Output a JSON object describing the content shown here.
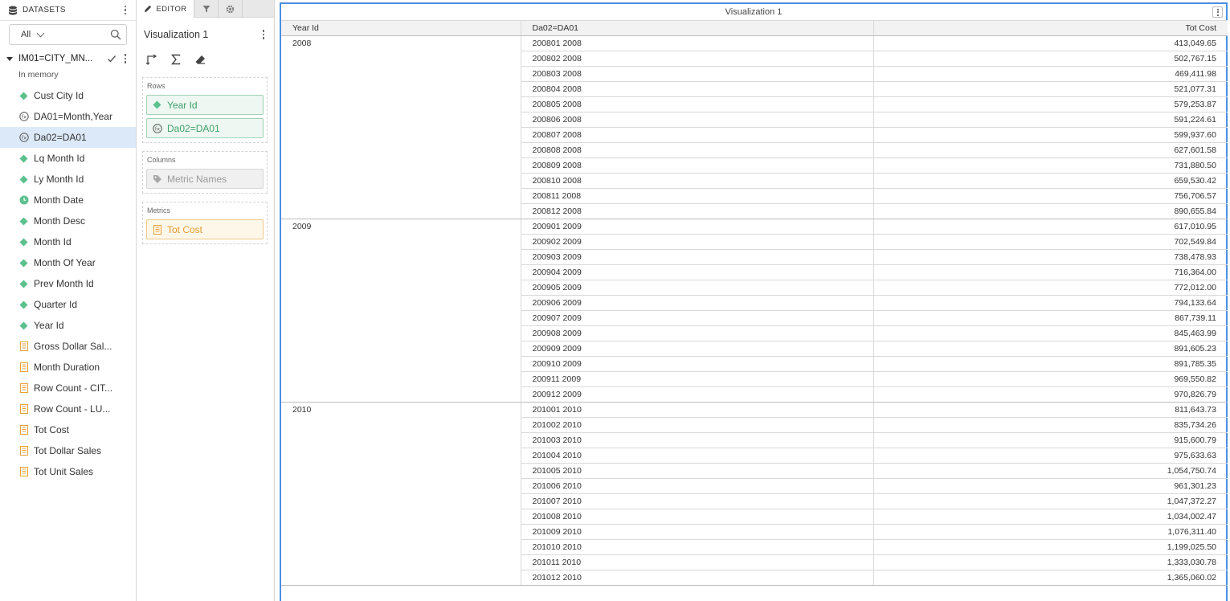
{
  "datasets_panel": {
    "title": "DATASETS",
    "filter_value": "All",
    "source": {
      "name": "IM01=CITY_MN...",
      "subtitle": "In memory"
    },
    "columns": [
      {
        "label": "Cust City Id",
        "icon": "attribute-icon"
      },
      {
        "label": "DA01=Month,Year",
        "icon": "fx-icon"
      },
      {
        "label": "Da02=DA01",
        "icon": "fx-icon",
        "selected": true
      },
      {
        "label": "Lq Month Id",
        "icon": "attribute-icon"
      },
      {
        "label": "Ly Month Id",
        "icon": "attribute-icon"
      },
      {
        "label": "Month Date",
        "icon": "clock-icon"
      },
      {
        "label": "Month Desc",
        "icon": "attribute-icon"
      },
      {
        "label": "Month Id",
        "icon": "attribute-icon"
      },
      {
        "label": "Month Of Year",
        "icon": "attribute-icon"
      },
      {
        "label": "Prev Month Id",
        "icon": "attribute-icon"
      },
      {
        "label": "Quarter Id",
        "icon": "attribute-icon"
      },
      {
        "label": "Year Id",
        "icon": "attribute-icon"
      },
      {
        "label": "Gross Dollar Sal...",
        "icon": "metric-icon"
      },
      {
        "label": "Month Duration",
        "icon": "metric-icon"
      },
      {
        "label": "Row Count - CIT...",
        "icon": "metric-icon"
      },
      {
        "label": "Row Count - LU...",
        "icon": "metric-icon"
      },
      {
        "label": "Tot Cost",
        "icon": "metric-icon"
      },
      {
        "label": "Tot Dollar Sales",
        "icon": "metric-icon"
      },
      {
        "label": "Tot Unit Sales",
        "icon": "metric-icon"
      }
    ]
  },
  "editor": {
    "tab_label": "EDITOR",
    "viz_title": "Visualization 1",
    "rows_caption": "Rows",
    "rows": [
      "Year Id",
      "Da02=DA01"
    ],
    "columns_caption": "Columns",
    "columns_item": "Metric Names",
    "metrics_caption": "Metrics",
    "metrics_item": "Tot Cost"
  },
  "visualization": {
    "title": "Visualization 1",
    "headers": [
      "Year Id",
      "Da02=DA01",
      "Tot Cost"
    ],
    "groups": [
      {
        "year": "2008",
        "rows": [
          [
            "200801 2008",
            "413,049.65"
          ],
          [
            "200802 2008",
            "502,767.15"
          ],
          [
            "200803 2008",
            "469,411.98"
          ],
          [
            "200804 2008",
            "521,077.31"
          ],
          [
            "200805 2008",
            "579,253.87"
          ],
          [
            "200806 2008",
            "591,224.61"
          ],
          [
            "200807 2008",
            "599,937.60"
          ],
          [
            "200808 2008",
            "627,601.58"
          ],
          [
            "200809 2008",
            "731,880.50"
          ],
          [
            "200810 2008",
            "659,530.42"
          ],
          [
            "200811 2008",
            "756,706.57"
          ],
          [
            "200812 2008",
            "890,655.84"
          ]
        ]
      },
      {
        "year": "2009",
        "rows": [
          [
            "200901 2009",
            "617,010.95"
          ],
          [
            "200902 2009",
            "702,549.84"
          ],
          [
            "200903 2009",
            "738,478.93"
          ],
          [
            "200904 2009",
            "716,364.00"
          ],
          [
            "200905 2009",
            "772,012.00"
          ],
          [
            "200906 2009",
            "794,133.64"
          ],
          [
            "200907 2009",
            "867,739.11"
          ],
          [
            "200908 2009",
            "845,463.99"
          ],
          [
            "200909 2009",
            "891,605.23"
          ],
          [
            "200910 2009",
            "891,785.35"
          ],
          [
            "200911 2009",
            "969,550.82"
          ],
          [
            "200912 2009",
            "970,826.79"
          ]
        ]
      },
      {
        "year": "2010",
        "rows": [
          [
            "201001 2010",
            "811,643.73"
          ],
          [
            "201002 2010",
            "835,734.26"
          ],
          [
            "201003 2010",
            "915,600.79"
          ],
          [
            "201004 2010",
            "975,633.63"
          ],
          [
            "201005 2010",
            "1,054,750.74"
          ],
          [
            "201006 2010",
            "961,301.23"
          ],
          [
            "201007 2010",
            "1,047,372.27"
          ],
          [
            "201008 2010",
            "1,034,002.47"
          ],
          [
            "201009 2010",
            "1,076,311.40"
          ],
          [
            "201010 2010",
            "1,199,025.50"
          ],
          [
            "201011 2010",
            "1,333,030.78"
          ],
          [
            "201012 2010",
            "1,365,060.02"
          ]
        ]
      }
    ]
  },
  "colors": {
    "attribute": "#5cc08f",
    "metric": "#e8a23a",
    "selection": "#dce9f8",
    "focus_border": "#4a90e2"
  }
}
